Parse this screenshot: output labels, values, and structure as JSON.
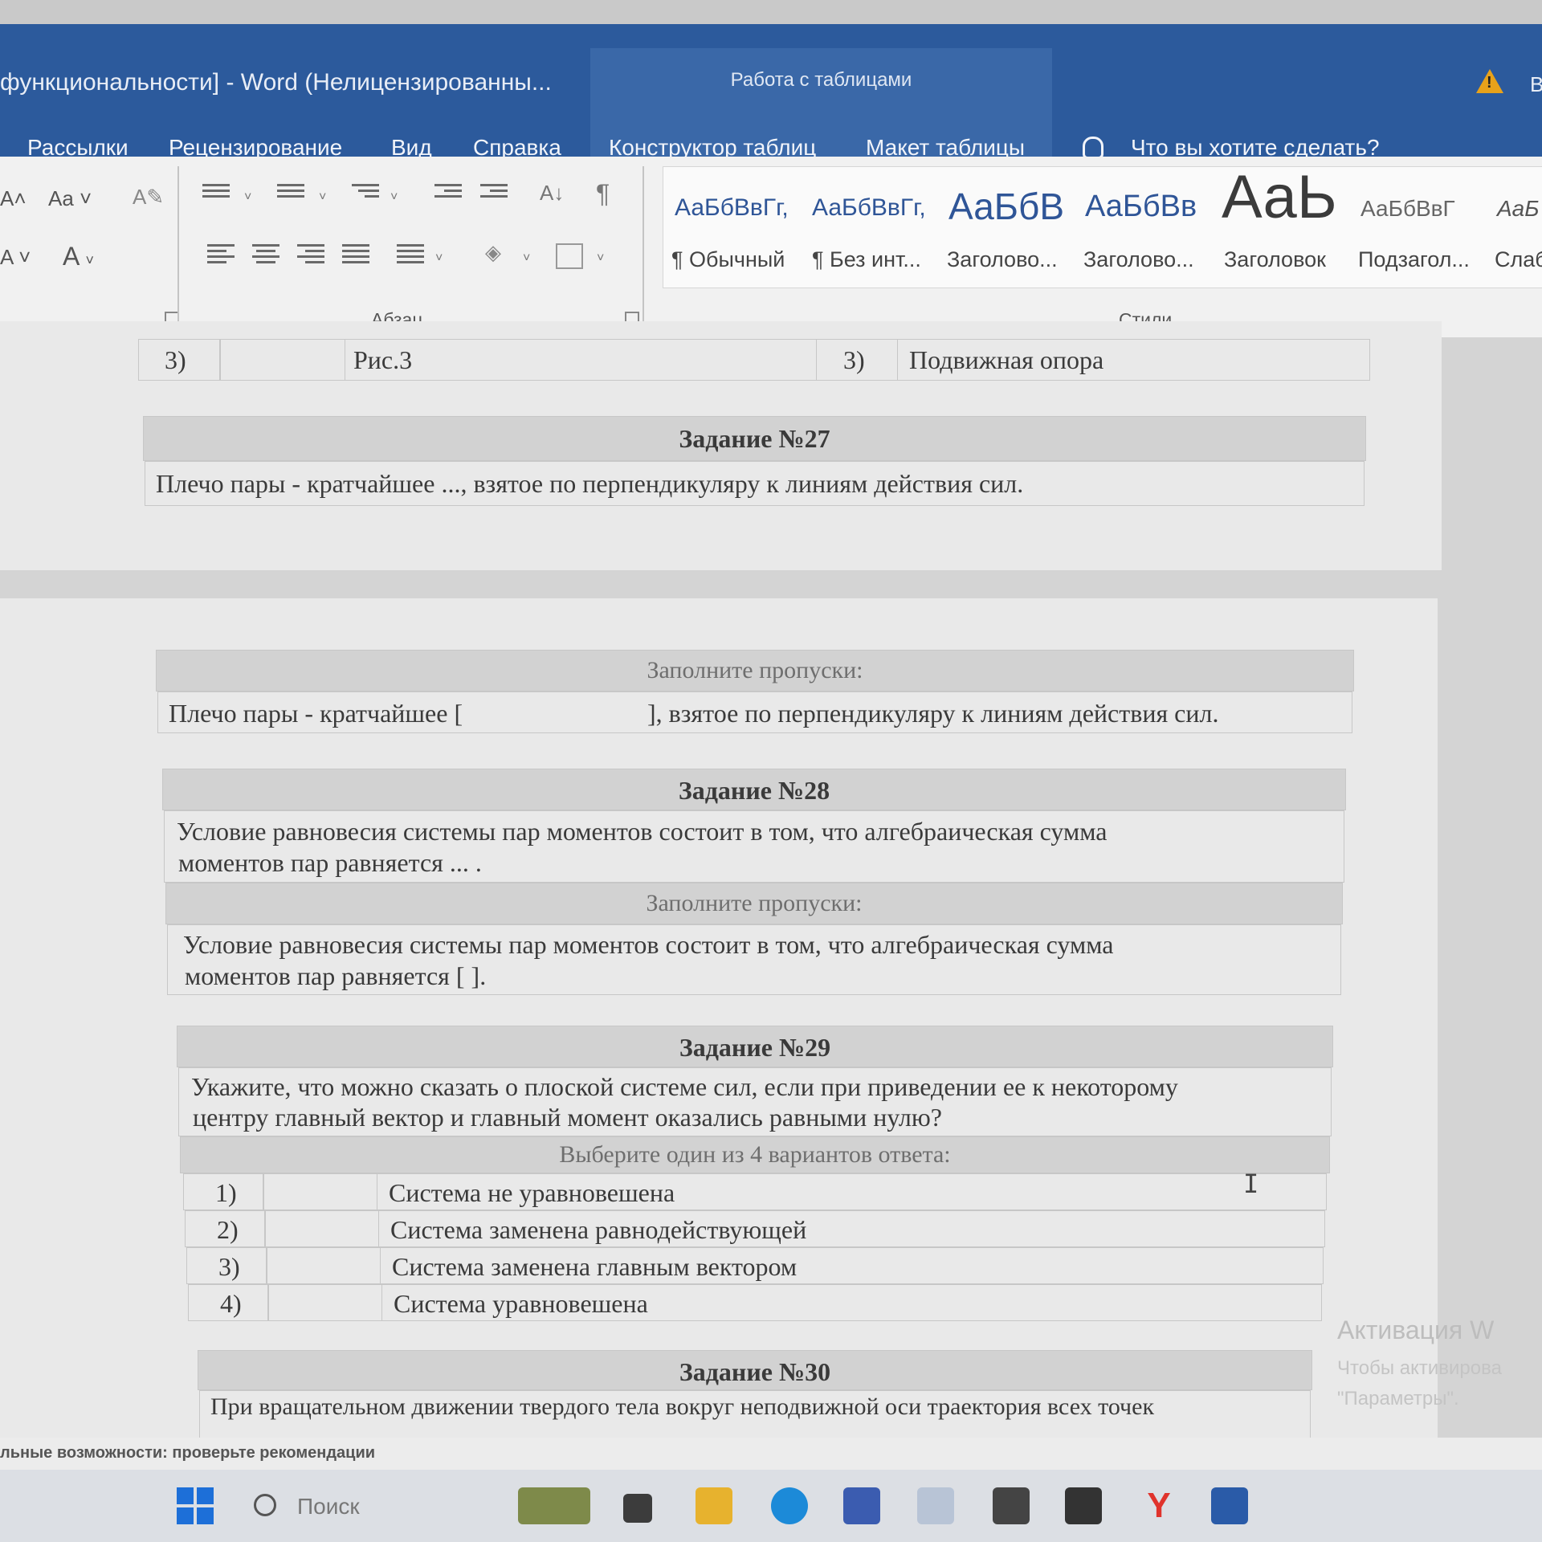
{
  "window": {
    "title": "функциональности]  -  Word (Нелицензированны...",
    "context_group": "Работа с таблицами",
    "title_cut": "В"
  },
  "tabs": [
    "Рассылки",
    "Рецензирование",
    "Вид",
    "Справка",
    "Конструктор таблиц",
    "Макет таблицы"
  ],
  "tell_me": "Что вы хотите сделать?",
  "ribbon": {
    "font_case_label": "Aa",
    "font_color_label": "A",
    "group_paragraph": "Абзац",
    "group_styles": "Стили",
    "styles": [
      {
        "preview": "АаБбВвГг,",
        "name": "¶ Обычный"
      },
      {
        "preview": "АаБбВвГг,",
        "name": "¶ Без инт..."
      },
      {
        "preview": "АаБбВ",
        "name": "Заголово..."
      },
      {
        "preview": "АаБбВв",
        "name": "Заголово..."
      },
      {
        "preview": "АаЬ",
        "name": "Заголовок"
      },
      {
        "preview": "АаБбВвГ",
        "name": "Подзагол..."
      },
      {
        "preview": "АаБ",
        "name": "Слаб"
      }
    ]
  },
  "document": {
    "top_row": {
      "num_left": "3)",
      "fig": "Рис.3",
      "num_right": "3)",
      "answer": "Подвижная опора"
    },
    "task27": {
      "title": "Задание №27",
      "question": "Плечо пары - кратчайшее ..., взятое по перпендикуляру к линиям действия сил.",
      "instruction": "Заполните пропуски:",
      "fill_left": "Плечо пары - кратчайшее [",
      "fill_right": "], взятое по перпендикуляру к линиям действия сил."
    },
    "task28": {
      "title": "Задание №28",
      "question_l1": "Условие равновесия системы пар моментов состоит в том, что алгебраическая сумма",
      "question_l2": "моментов пар равняется ... .",
      "instruction": "Заполните пропуски:",
      "fill_l1": "Условие равновесия системы пар моментов состоит в том, что алгебраическая сумма",
      "fill_l2": "моментов пар равняется [        ]."
    },
    "task29": {
      "title": "Задание №29",
      "question_l1": "Укажите, что можно сказать о плоской системе сил, если при приведении ее к некоторому",
      "question_l2": "центру главный вектор и главный момент оказались равными нулю?",
      "instruction": "Выберите один из 4 вариантов ответа:",
      "options": [
        {
          "num": "1)",
          "text": "Система не уравновешена"
        },
        {
          "num": "2)",
          "text": "Система заменена равнодействующей"
        },
        {
          "num": "3)",
          "text": "Система заменена главным вектором"
        },
        {
          "num": "4)",
          "text": "Система уравновешена"
        }
      ]
    },
    "task30": {
      "title": "Задание №30",
      "question_l1": "При вращательном движении твердого тела вокруг неподвижной оси траектория всех точек"
    },
    "watermark": {
      "title": "Активация W",
      "line1": "Чтобы активирова",
      "line2": "\"Параметры\"."
    }
  },
  "statusbar": {
    "text": "льные возможности: проверьте рекомендации"
  },
  "taskbar": {
    "search_label": "Поиск",
    "apps": [
      "widgets-icon",
      "folder-icon",
      "file-explorer-icon",
      "edge-icon",
      "store-icon",
      "app-icon",
      "xbox-icon",
      "r-app-icon",
      "yandex-icon",
      "word-icon"
    ]
  },
  "colors": {
    "ribbon_blue": "#2c5a9c",
    "context_blue": "#3a68a8",
    "style_blue": "#2f5597"
  }
}
